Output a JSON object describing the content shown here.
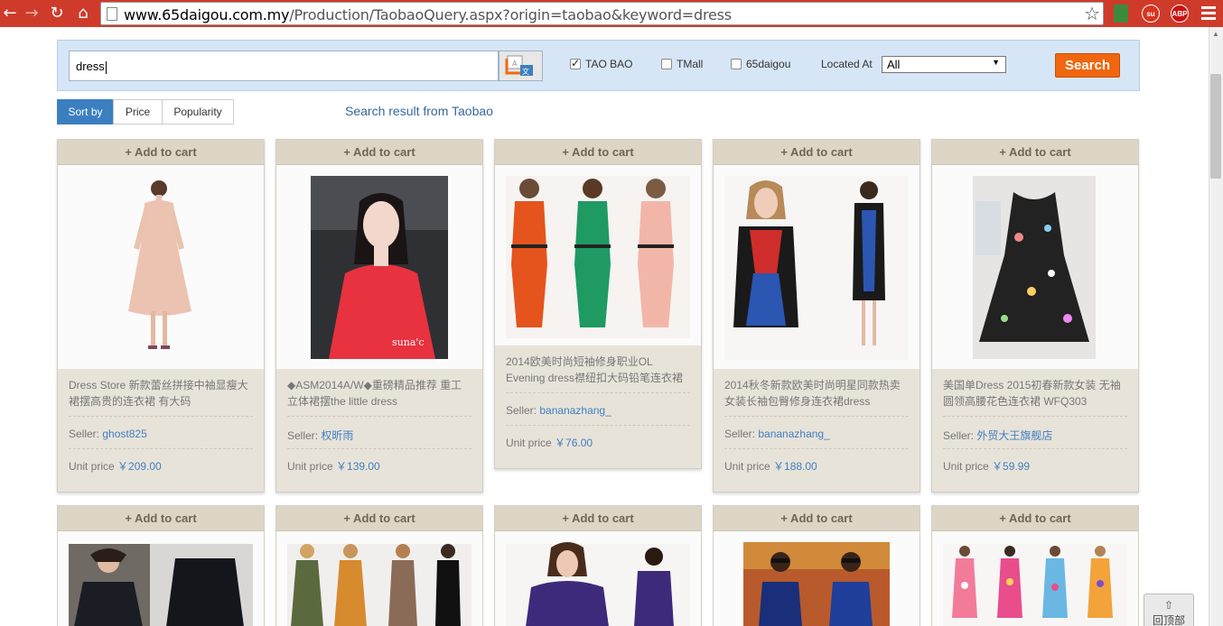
{
  "browser": {
    "url_host": "www.65daigou.com.my",
    "url_path": "/Production/TaobaoQuery.aspx?origin=taobao&keyword=dress",
    "ext_1": "ABP"
  },
  "search": {
    "query": "dress",
    "options": [
      {
        "label": "TAO BAO",
        "checked": true
      },
      {
        "label": "TMall",
        "checked": false
      },
      {
        "label": "65daigou",
        "checked": false
      }
    ],
    "located_label": "Located At",
    "located_value": "All",
    "button_label": "Search"
  },
  "sort": {
    "tabs": [
      "Sort by",
      "Price",
      "Popularity"
    ],
    "active": 0
  },
  "result_note": "Search result from Taobao",
  "labels": {
    "add_to_cart": "+ Add to cart",
    "seller": "Seller:",
    "unit_price": "Unit price",
    "back_top": "回顶部"
  },
  "colors": {
    "accent_blue": "#3c7fc1",
    "search_orange": "#f0660e",
    "browser_red": "#cf3b2b"
  },
  "products": [
    {
      "title": "Dress Store 新款蕾丝拼接中袖显瘦大裙摆高贵的连衣裙 有大码",
      "seller": "ghost825",
      "price": "￥209.00",
      "image": "dress-peach-lace"
    },
    {
      "title": "◆ASM2014A/W◆重磅精品推荐 重工立体裙摆the little dress",
      "seller": "权昕雨",
      "price": "￥139.00",
      "image": "dress-red-car"
    },
    {
      "title": "2014欧美时尚短袖修身职业OL Evening dress襟纽扣大码铅笔连衣裙",
      "seller": "bananazhang_",
      "price": "￥76.00",
      "image": "dress-three-colors"
    },
    {
      "title": "2014秋冬新款欧美时尚明星同款热卖女装长袖包臀修身连衣裙dress",
      "seller": "bananazhang_",
      "price": "￥188.00",
      "image": "dress-colorblock"
    },
    {
      "title": "美国单Dress 2015初春新款女装 无袖圆领高腰花色连衣裙 WFQ303",
      "seller": "外贸大王旗舰店",
      "price": "￥59.99",
      "image": "dress-black-print"
    },
    {
      "image": "dress-black-shirt"
    },
    {
      "image": "dress-olive-maxi"
    },
    {
      "image": "dress-purple"
    },
    {
      "image": "dress-blue-celebrity"
    },
    {
      "image": "dress-floral-print"
    }
  ]
}
